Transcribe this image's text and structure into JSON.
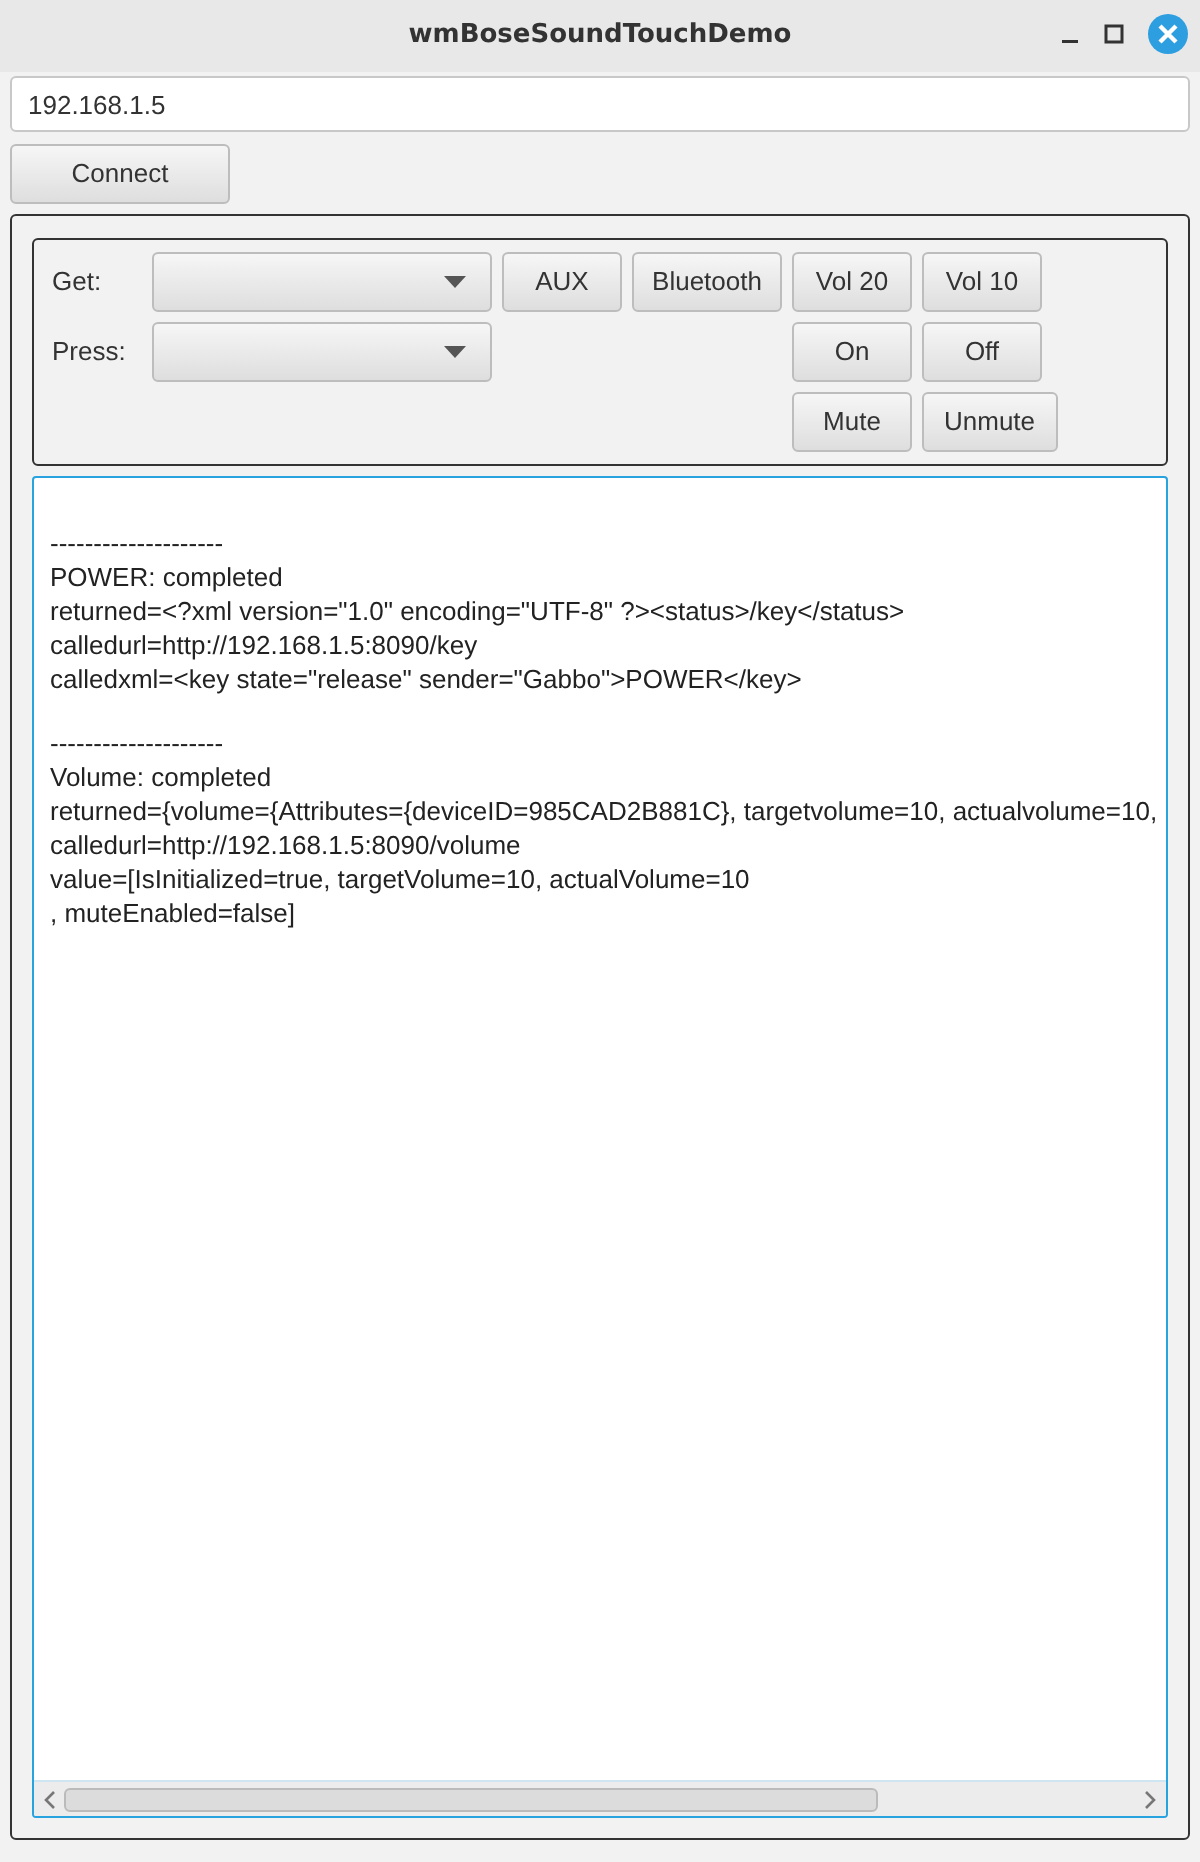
{
  "window": {
    "title": "wmBoseSoundTouchDemo"
  },
  "address": {
    "value": "192.168.1.5"
  },
  "connect_button": "Connect",
  "controls": [
    {
      "label": "Get:",
      "buttons": [
        "AUX",
        "Bluetooth",
        "Vol 20",
        "Vol 10"
      ]
    },
    {
      "label": "Press:",
      "buttons": [
        "On",
        "Off"
      ]
    },
    {
      "buttons": [
        "Mute",
        "Unmute"
      ]
    }
  ],
  "output": {
    "blocks": [
      [
        "--------------------",
        "POWER: completed",
        "returned=<?xml version=\"1.0\" encoding=\"UTF-8\" ?><status>/key</status>",
        "calledurl=http://192.168.1.5:8090/key",
        "calledxml=<key state=\"release\" sender=\"Gabbo\">POWER</key>"
      ],
      [
        "--------------------",
        "Volume: completed",
        "returned={volume={Attributes={deviceID=985CAD2B881C}, targetvolume=10, actualvolume=10,",
        "calledurl=http://192.168.1.5:8090/volume",
        "value=[IsInitialized=true, targetVolume=10, actualVolume=10",
        ", muteEnabled=false]"
      ]
    ]
  }
}
